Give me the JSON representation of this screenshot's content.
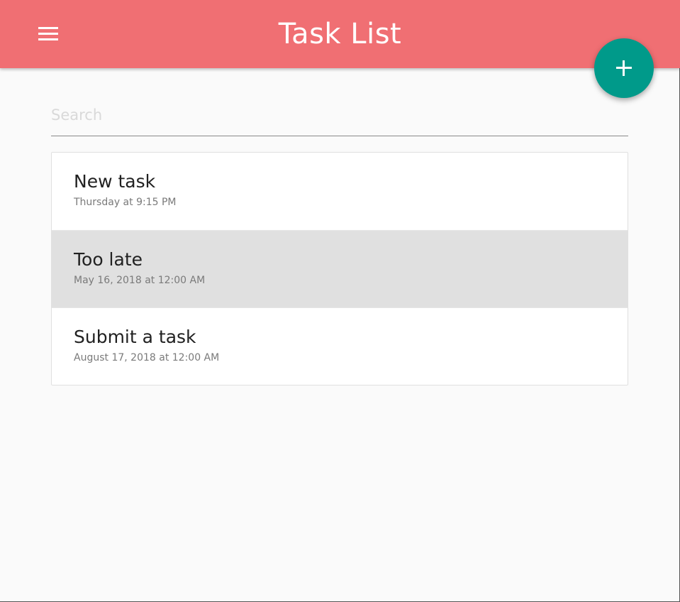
{
  "app_bar": {
    "title": "Task List",
    "menu_icon": "hamburger-menu-icon",
    "background": "#f06f73"
  },
  "fab": {
    "icon": "plus-icon",
    "color": "#009a8a"
  },
  "search": {
    "placeholder": "Search",
    "value": ""
  },
  "tasks": [
    {
      "title": "New task",
      "date": "Thursday at 9:15 PM",
      "selected": false
    },
    {
      "title": "Too late",
      "date": "May 16, 2018 at 12:00 AM",
      "selected": true
    },
    {
      "title": "Submit a task",
      "date": "August 17, 2018 at 12:00 AM",
      "selected": false
    }
  ]
}
